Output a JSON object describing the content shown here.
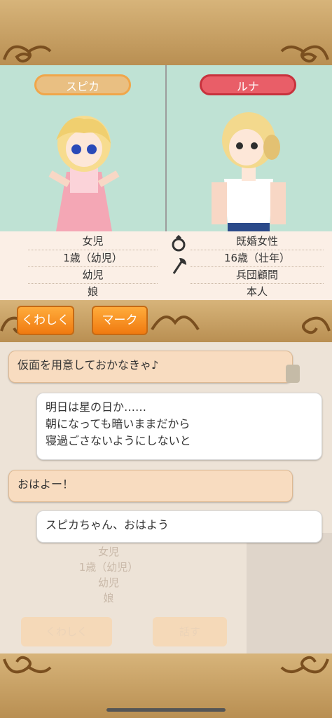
{
  "characters": {
    "left": {
      "name": "スピカ",
      "pill_color": "#e9bf82",
      "pill_border": "#f0a64a",
      "info": [
        "女児",
        "1歳（幼児）",
        "幼児",
        "娘"
      ]
    },
    "right": {
      "name": "ルナ",
      "pill_color": "#e95e68",
      "pill_border": "#c8323d",
      "info": [
        "既婚女性",
        "16歳（壮年）",
        "兵団顧問",
        "本人"
      ]
    }
  },
  "icons": {
    "ring": "ring-icon",
    "axe": "axe-icon"
  },
  "buttons": {
    "details": "くわしく",
    "mark": "マーク"
  },
  "chat": {
    "messages": [
      {
        "speaker": "left",
        "text": "仮面を用意しておかなきゃ♪"
      },
      {
        "speaker": "right",
        "text": "明日は星の日か……\n朝になっても暗いままだから\n寝過ごさないようにしないと"
      },
      {
        "speaker": "left",
        "text": "おはよー！"
      },
      {
        "speaker": "right",
        "text": "スピカちゃん、おはよう"
      }
    ]
  },
  "background_ghost": {
    "info": [
      "女児",
      "1歳（幼児）",
      "幼児",
      "娘"
    ],
    "details_button": "くわしく",
    "talk_button": "話す"
  },
  "colors": {
    "gold": "#c8a267",
    "orange": "#f07a10",
    "mint": "#bfe2d4"
  }
}
